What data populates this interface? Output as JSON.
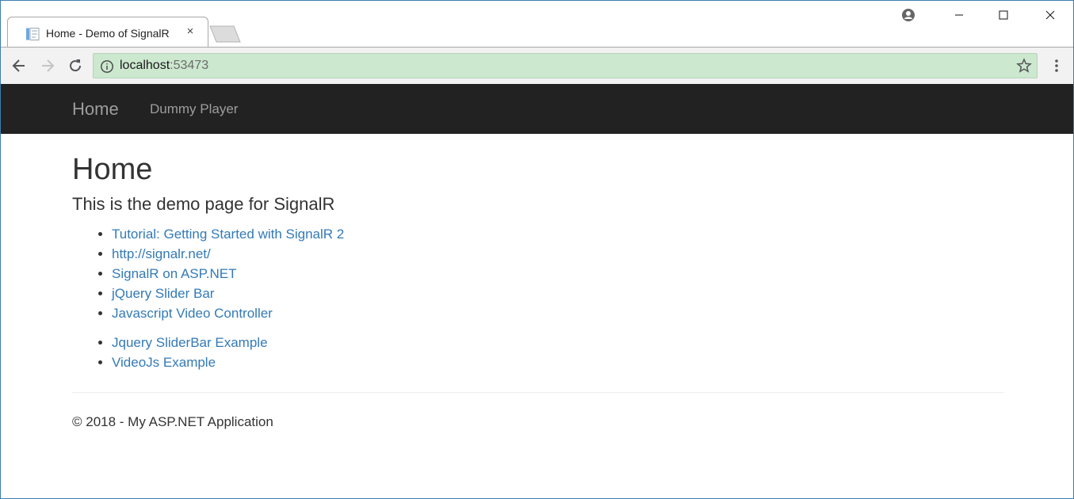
{
  "browser": {
    "tab": {
      "title": "Home - Demo of SignalR",
      "favicon": "page-icon",
      "close": "×"
    },
    "url": {
      "host": "localhost",
      "port": ":53473"
    },
    "window_controls": [
      "minimize",
      "maximize",
      "close"
    ]
  },
  "site": {
    "brand": "Home",
    "nav": [
      {
        "label": "Dummy Player"
      }
    ]
  },
  "main": {
    "title": "Home",
    "lead": "This is the demo page for SignalR",
    "links": [
      {
        "label": "Tutorial: Getting Started with SignalR 2"
      },
      {
        "label": "http://signalr.net/"
      },
      {
        "label": "SignalR on ASP.NET"
      },
      {
        "label": "jQuery Slider Bar"
      },
      {
        "label": "Javascript Video Controller"
      }
    ],
    "examples": [
      {
        "label": "Jquery SliderBar Example"
      },
      {
        "label": "VideoJs Example"
      }
    ]
  },
  "footer": {
    "text": "© 2018 - My ASP.NET Application"
  },
  "colors": {
    "navbar": "#222222",
    "link": "#337ab7",
    "omnibox": "#cce8cf",
    "window_border": "#3c7fb1"
  }
}
